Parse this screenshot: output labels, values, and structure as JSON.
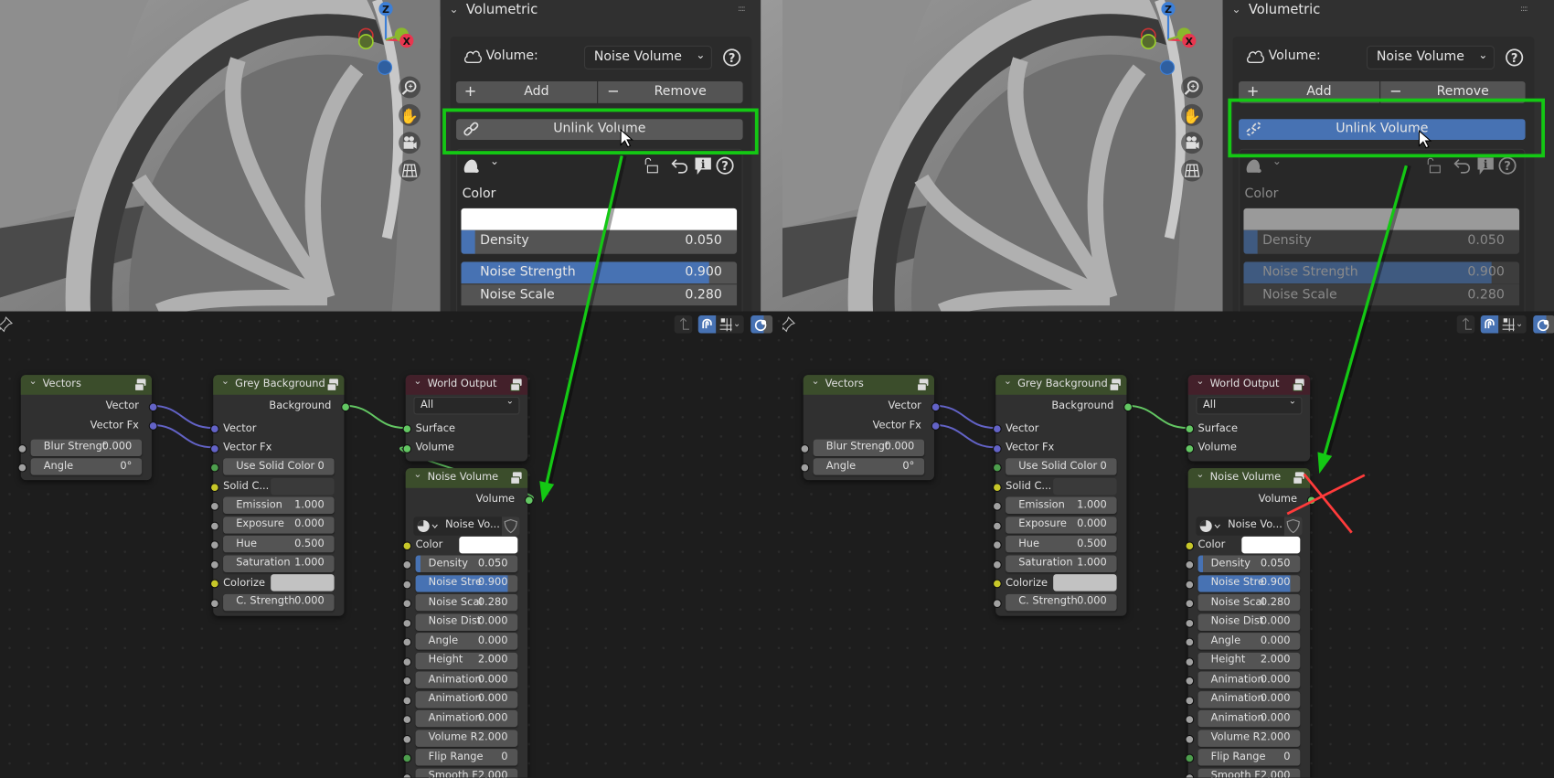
{
  "panel": {
    "section_title": "Volumetric",
    "volume_label": "Volume:",
    "volume_value": "Noise Volume",
    "add_label": "Add",
    "remove_label": "Remove",
    "unlink_label": "Unlink Volume",
    "color_label": "Color",
    "color_value": "#ffffff",
    "props": [
      {
        "label": "Density",
        "value": "0.050",
        "fill": 0.05
      },
      {
        "label": "Noise Strength",
        "value": "0.900",
        "fill": 0.9
      },
      {
        "label": "Noise Scale",
        "value": "0.280"
      }
    ],
    "icons": [
      "cloud-icon",
      "help-icon",
      "plus-icon",
      "minus-icon",
      "unlink-icon",
      "material-icon",
      "lock-icon",
      "undo-icon",
      "info-icon"
    ]
  },
  "nodes": [
    {
      "title": "Vectors",
      "header_color": "#3b4d2b",
      "rows": [
        {
          "type": "out",
          "label": "Vector",
          "socket": "vector"
        },
        {
          "type": "out",
          "label": "Vector Fx",
          "socket": "vector"
        },
        {
          "type": "field",
          "label": "Blur Strengt",
          "value": "0.000",
          "socket": "float"
        },
        {
          "type": "field",
          "label": "Angle",
          "value": "0°",
          "socket": "float"
        }
      ]
    },
    {
      "title": "Grey Background",
      "header_color": "#3b4d2b",
      "rows": [
        {
          "type": "out",
          "label": "Background",
          "socket": "shader"
        },
        {
          "type": "in",
          "label": "Vector",
          "socket": "vector"
        },
        {
          "type": "in",
          "label": "Vector Fx",
          "socket": "vector"
        },
        {
          "type": "field",
          "label": "Use Solid Color",
          "value": "0",
          "socket": "int"
        },
        {
          "type": "color",
          "label": "Solid C...",
          "swatch": "#3a3a3a",
          "socket": "color"
        },
        {
          "type": "field",
          "label": "Emission",
          "value": "1.000",
          "socket": "float"
        },
        {
          "type": "field",
          "label": "Exposure",
          "value": "0.000",
          "socket": "float"
        },
        {
          "type": "field",
          "label": "Hue",
          "value": "0.500",
          "socket": "float"
        },
        {
          "type": "field",
          "label": "Saturation",
          "value": "1.000",
          "socket": "float"
        },
        {
          "type": "color",
          "label": "Colorize",
          "swatch": "#c2c2c2",
          "socket": "color"
        },
        {
          "type": "field",
          "label": "C. Strength",
          "value": "0.000",
          "socket": "float"
        }
      ]
    },
    {
      "title": "World Output",
      "header_color": "#43202a",
      "rows": [
        {
          "type": "select",
          "label": "All"
        },
        {
          "type": "in",
          "label": "Surface",
          "socket": "shader"
        },
        {
          "type": "in",
          "label": "Volume",
          "socket": "shader"
        }
      ]
    },
    {
      "title": "Noise Volume",
      "header_color": "#3b4d2b",
      "rows": [
        {
          "type": "out",
          "label": "Volume",
          "socket": "shader"
        },
        {
          "type": "datablock",
          "label": "Noise Vo..."
        },
        {
          "type": "color",
          "label": "Color",
          "swatch": "#ffffff",
          "socket": "color"
        },
        {
          "type": "field",
          "label": "Density",
          "value": "0.050",
          "fill": 0.05,
          "socket": "float"
        },
        {
          "type": "field",
          "label": "Noise Stre",
          "value": "0.900",
          "fill": 0.9,
          "socket": "float"
        },
        {
          "type": "field",
          "label": "Noise Scal",
          "value": "0.280",
          "socket": "float"
        },
        {
          "type": "field",
          "label": "Noise Dist",
          "value": "0.000",
          "socket": "float"
        },
        {
          "type": "field",
          "label": "Angle",
          "value": "0.000",
          "socket": "float"
        },
        {
          "type": "field",
          "label": "Height",
          "value": "2.000",
          "socket": "float"
        },
        {
          "type": "field",
          "label": "Animation",
          "value": "0.000",
          "socket": "float"
        },
        {
          "type": "field",
          "label": "Animation",
          "value": "0.000",
          "socket": "float"
        },
        {
          "type": "field",
          "label": "Animation",
          "value": "0.000",
          "socket": "float"
        },
        {
          "type": "field",
          "label": "Volume R",
          "value": "2.000",
          "socket": "float"
        },
        {
          "type": "field",
          "label": "Flip Range",
          "value": "0",
          "socket": "int"
        },
        {
          "type": "field",
          "label": "Smooth F",
          "value": "2.000",
          "socket": "float"
        }
      ]
    }
  ],
  "comparison": [
    {
      "unlink_hovered": false,
      "panel_dimmed": false,
      "links": [
        {
          "from_node": "Vectors",
          "from_socket": "Vector",
          "to_node": "Grey Background",
          "to_socket": "Vector"
        },
        {
          "from_node": "Vectors",
          "from_socket": "Vector Fx",
          "to_node": "Grey Background",
          "to_socket": "Vector Fx"
        },
        {
          "from_node": "Grey Background",
          "from_socket": "Background",
          "to_node": "World Output",
          "to_socket": "Surface"
        },
        {
          "from_node": "Noise Volume",
          "from_socket": "Volume",
          "to_node": "World Output",
          "to_socket": "Volume"
        }
      ]
    },
    {
      "unlink_hovered": true,
      "panel_dimmed": true,
      "removed_link_marker": "red-x",
      "links": [
        {
          "from_node": "Vectors",
          "from_socket": "Vector",
          "to_node": "Grey Background",
          "to_socket": "Vector"
        },
        {
          "from_node": "Vectors",
          "from_socket": "Vector Fx",
          "to_node": "Grey Background",
          "to_socket": "Vector Fx"
        },
        {
          "from_node": "Grey Background",
          "from_socket": "Background",
          "to_node": "World Output",
          "to_socket": "Surface"
        }
      ]
    }
  ],
  "colors": {
    "accent_blue": "#4772b3",
    "annotation_green": "#14c814",
    "annotation_red": "#ff3b3b",
    "socket_vector": "#6363c7",
    "socket_shader": "#63c763",
    "socket_float": "#a1a1a1",
    "socket_color": "#c7c729",
    "socket_int": "#4d9e4d"
  }
}
